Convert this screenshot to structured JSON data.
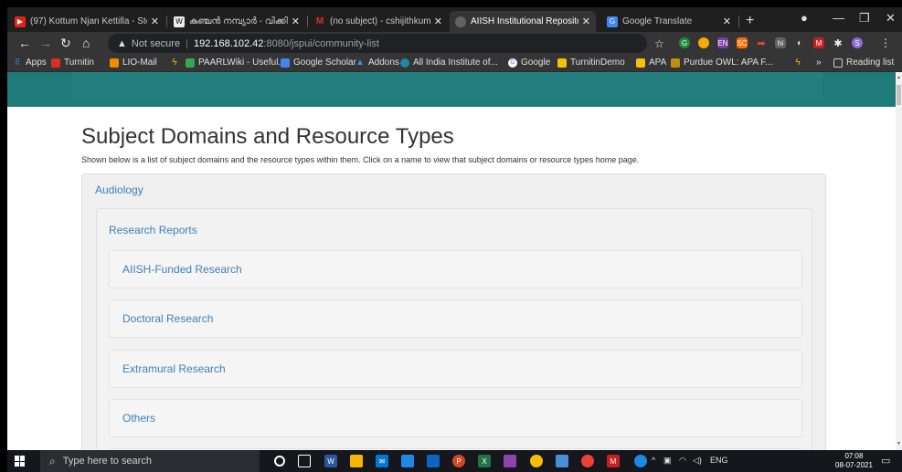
{
  "browser": {
    "tabs": [
      {
        "title": "(97) Kottum Njan Kettilla - Sto",
        "icon": "youtube-icon",
        "color": "#e62117"
      },
      {
        "title": "കുഞ്ചൻ നമ്പ്യാർ - വിക്കി",
        "icon": "wikipedia-icon",
        "color": "#333333"
      },
      {
        "title": "(no subject) - cshijithkumar@",
        "icon": "gmail-icon",
        "color": "#d93025"
      },
      {
        "title": "AIISH Institutional Repository",
        "icon": "globe-icon",
        "color": "#5f6368",
        "active": true
      },
      {
        "title": "Google Translate",
        "icon": "translate-icon",
        "color": "#4285f4"
      }
    ],
    "address": {
      "security_label": "Not secure",
      "host": "192.168.102.42",
      "path": ":8080/jspui/community-list"
    },
    "bookmarks": [
      {
        "label": "Apps",
        "icon": "apps-grid-icon",
        "color": "#4285f4"
      },
      {
        "label": "Turnitin",
        "icon": "turnitin-icon",
        "color": "#d93025"
      },
      {
        "label": "LIO-Mail",
        "icon": "lio-mail-icon",
        "color": "#f28b00"
      },
      {
        "label": "",
        "icon": "lightning-icon",
        "color": "#f4c20d"
      },
      {
        "label": "PAARLWiki - Useful...",
        "icon": "paarl-icon",
        "color": "#34a853"
      },
      {
        "label": "Google Scholar",
        "icon": "scholar-icon",
        "color": "#4285f4"
      },
      {
        "label": "Addons",
        "icon": "addons-icon",
        "color": "#4285f4"
      },
      {
        "label": "All India Institute of...",
        "icon": "aiish-icon",
        "color": "#1e88a8"
      },
      {
        "label": "Google",
        "icon": "google-icon",
        "color": "#ffffff"
      },
      {
        "label": "TurnitinDemo",
        "icon": "folder-icon",
        "color": "#f4c20d"
      },
      {
        "label": "APA",
        "icon": "folder-icon",
        "color": "#f4c20d"
      },
      {
        "label": "Purdue OWL: APA F...",
        "icon": "purdue-icon",
        "color": "#c28e0e"
      },
      {
        "label": "",
        "icon": "lightning-icon",
        "color": "#f4c20d"
      }
    ],
    "reading_list_label": "Reading list",
    "overflow_label": "»"
  },
  "page": {
    "title": "Subject Domains and Resource Types",
    "description": "Shown below is a list of subject domains and the resource types within them. Click on a name to view that subject domains or resource types home page.",
    "community": "Audiology",
    "sub_community": "Research Reports",
    "collections": [
      "AIISH-Funded Research",
      "Doctoral Research",
      "Extramural Research",
      "Others"
    ]
  },
  "taskbar": {
    "search_placeholder": "Type here to search",
    "language": "ENG",
    "time": "07:08",
    "date": "08-07-2021"
  }
}
